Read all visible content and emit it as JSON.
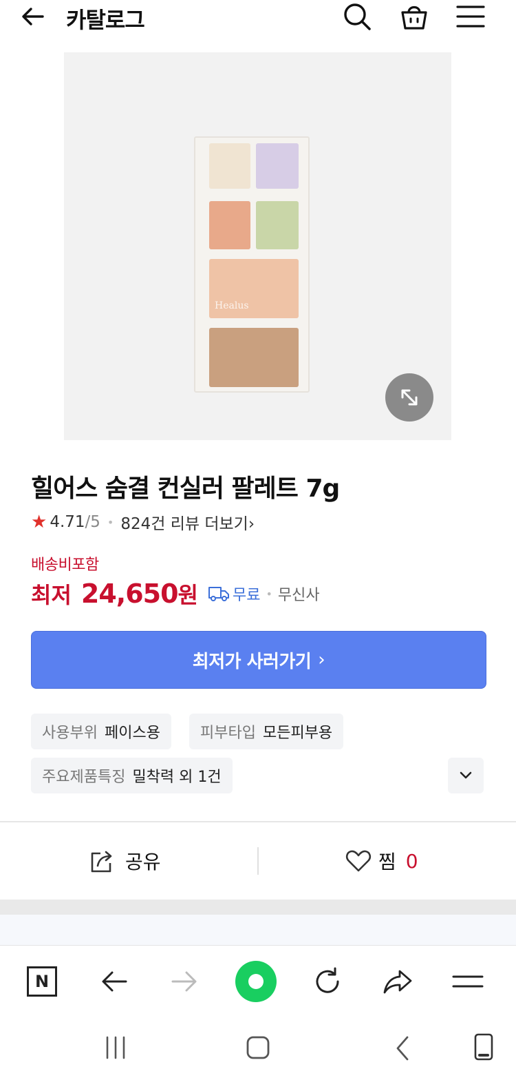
{
  "header": {
    "title": "카탈로그",
    "back_icon": "arrow-left-icon",
    "search_icon": "search-icon",
    "cart_icon": "shopping-bag-icon",
    "menu_icon": "hamburger-menu-icon"
  },
  "product_image": {
    "alt": "힐어스 숨결 컨실러 팔레트",
    "brand_mark": "Healus",
    "expand_icon": "expand-arrows-icon"
  },
  "product": {
    "name": "힐어스 숨결 컨실러 팔레트 7g",
    "rating_value": "4.71",
    "rating_denominator": "/5",
    "review_link": "824건 리뷰 더보기",
    "review_chevron": "›"
  },
  "pricing": {
    "shipping_tag": "배송비포함",
    "prefix": "최저",
    "price": "24,650",
    "unit": "원",
    "delivery_label": "무료",
    "seller": "무신사"
  },
  "cta": {
    "label": "최저가 사러가기",
    "chevron": "›"
  },
  "attributes": [
    {
      "key": "사용부위",
      "value": "페이스용"
    },
    {
      "key": "피부타입",
      "value": "모든피부용"
    },
    {
      "key": "주요제품특징",
      "value": "밀착력 외 1건"
    }
  ],
  "actions": {
    "share_label": "공유",
    "wish_label": "찜",
    "wish_count": "0"
  },
  "browser_toolbar": {
    "n_label": "N"
  },
  "colors": {
    "price_red": "#c8102e",
    "cta_blue": "#5a80f0",
    "delivery_blue": "#3b6fd9",
    "green": "#19ce60"
  }
}
